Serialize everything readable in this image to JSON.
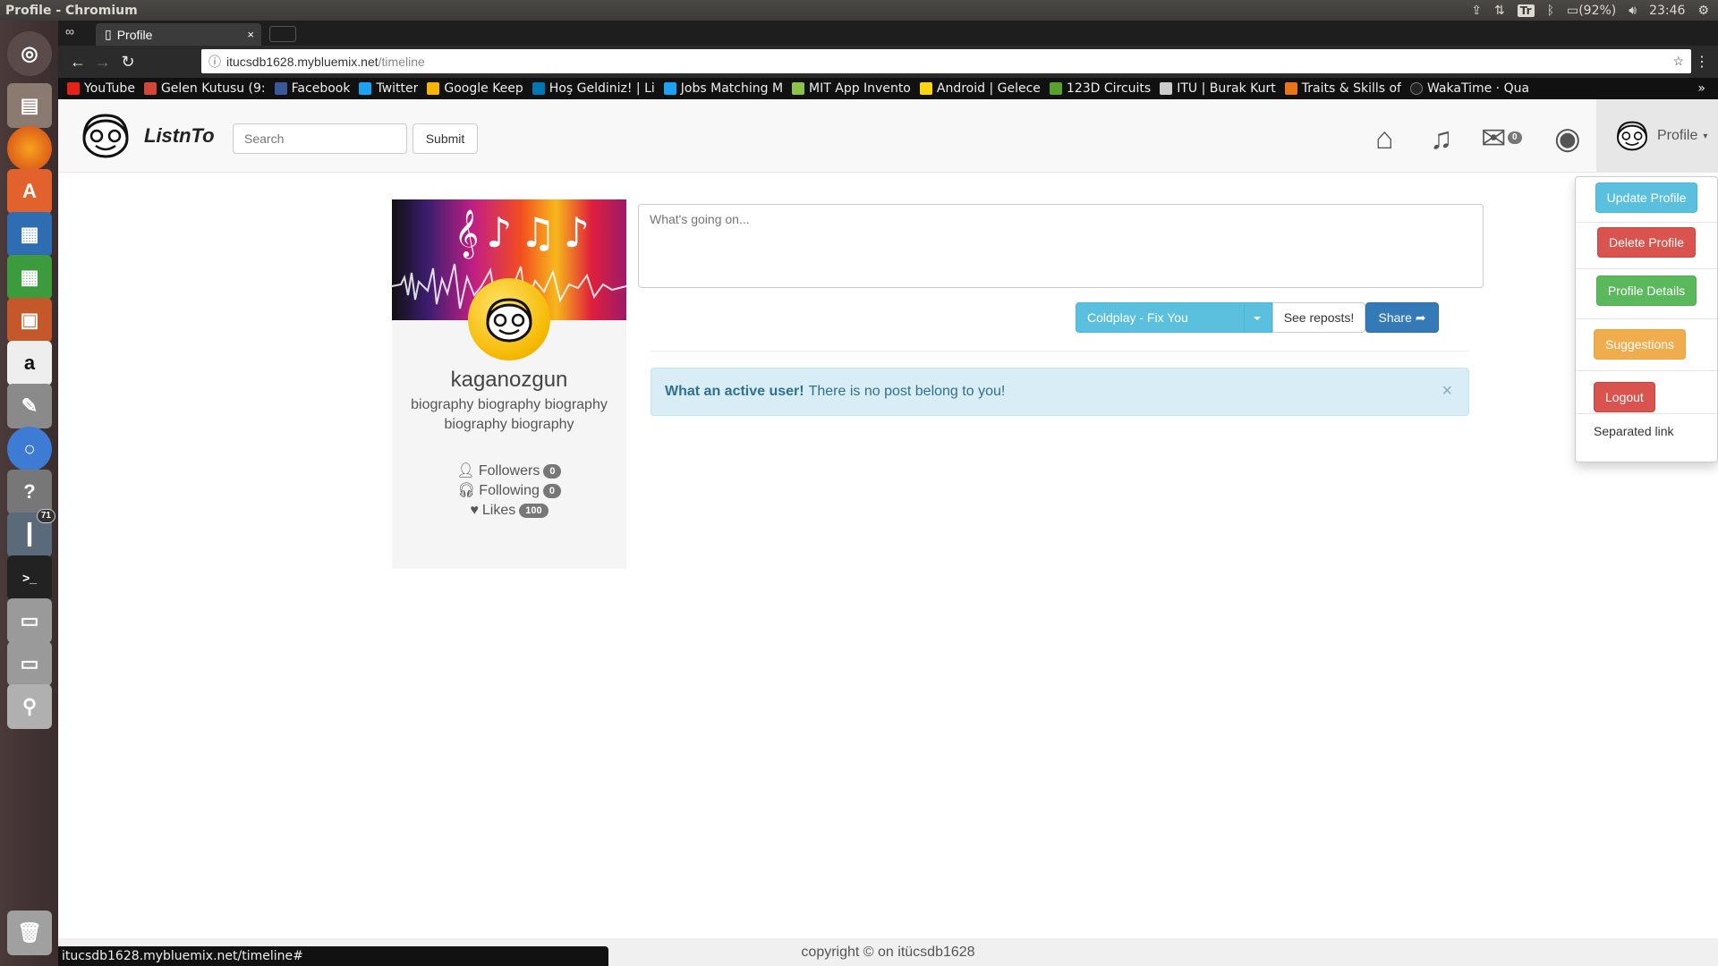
{
  "system": {
    "window_title": "Profile - Chromium",
    "keyboard_layout": "Tr",
    "battery": "(92%)",
    "clock": "23:46"
  },
  "launcher": {
    "items": [
      {
        "name": "ubuntu-dash-icon"
      },
      {
        "name": "files-icon"
      },
      {
        "name": "firefox-icon"
      },
      {
        "name": "software-center-icon"
      },
      {
        "name": "writer-icon"
      },
      {
        "name": "calc-icon"
      },
      {
        "name": "impress-icon"
      },
      {
        "name": "amazon-icon",
        "label": "a"
      },
      {
        "name": "settings-icon"
      },
      {
        "name": "chromium-icon"
      },
      {
        "name": "help-icon",
        "label": "?"
      },
      {
        "name": "thermometer-icon",
        "badge": "71"
      },
      {
        "name": "terminal-icon",
        "label": ">_"
      },
      {
        "name": "drive-icon"
      },
      {
        "name": "drive-icon-2"
      },
      {
        "name": "installer-icon"
      },
      {
        "name": "trash-icon"
      }
    ]
  },
  "browser": {
    "tab_title": "Profile",
    "tab_close": "×",
    "url_host": "itucsdb1628.mybluemix.net",
    "url_path": "/timeline",
    "status_url": "itucsdb1628.mybluemix.net/timeline#",
    "bookmarks": [
      {
        "label": "YouTube",
        "color": "#e62117"
      },
      {
        "label": "Gelen Kutusu (9:",
        "color": "#d44638"
      },
      {
        "label": "Facebook",
        "color": "#3b5998"
      },
      {
        "label": "Twitter",
        "color": "#1da1f2"
      },
      {
        "label": "Google Keep",
        "color": "#f7b500"
      },
      {
        "label": "Hoş Geldiniz! | Li",
        "color": "#0077b5"
      },
      {
        "label": "Jobs Matching M",
        "color": "#1da1f2"
      },
      {
        "label": "MIT App Invento",
        "color": "#8bc34a"
      },
      {
        "label": "Android | Gelece",
        "color": "#f7d414"
      },
      {
        "label": "123D Circuits",
        "color": "#5aa02c"
      },
      {
        "label": "ITU | Burak Kurt",
        "color": "#cccccc"
      },
      {
        "label": "Traits & Skills of",
        "color": "#e8751a"
      },
      {
        "label": "WakaTime · Qua",
        "color": "#222222"
      }
    ],
    "bookmarks_more": "»"
  },
  "app": {
    "brand": "ListnTo",
    "search_placeholder": "Search",
    "submit_label": "Submit",
    "messages_count": "0",
    "profile_menu_label": "Profile",
    "dropdown": {
      "update": "Update Profile",
      "delete": "Delete Profile",
      "details": "Profile Details",
      "suggestions": "Suggestions",
      "logout": "Logout",
      "separated": "Separated link"
    },
    "profile": {
      "username": "kaganozgun",
      "bio": "biography biography biography biography biography",
      "followers_label": "Followers",
      "followers_count": "0",
      "following_label": "Following",
      "following_count": "0",
      "likes_label": "Likes",
      "likes_count": "100"
    },
    "post": {
      "placeholder": "What's going on...",
      "song_selected": "Coldplay - Fix You",
      "reposts_label": "See reposts!",
      "share_label": "Share"
    },
    "alert": {
      "strong": "What an active user!",
      "text": "There is no post belong to you!",
      "close": "×"
    },
    "footer": "copyright © on itücsdb1628"
  }
}
